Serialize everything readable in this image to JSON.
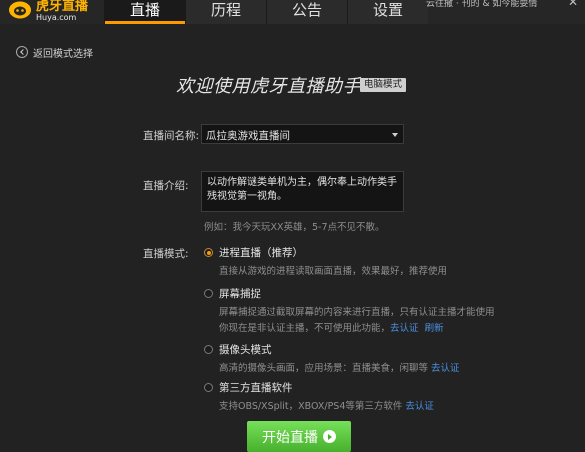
{
  "brand": {
    "name": "虎牙直播",
    "url": "Huya.com"
  },
  "tabs": [
    {
      "label": "直播",
      "active": true
    },
    {
      "label": "历程",
      "active": false
    },
    {
      "label": "公告",
      "active": false
    },
    {
      "label": "设置",
      "active": false
    }
  ],
  "user_area_text": "云往撒 · 刊的 & 如今能耍情",
  "back_label": "返回模式选择",
  "title": "欢迎使用虎牙直播助手",
  "mode_badge": "电脑模式",
  "form": {
    "room_name_label": "直播间名称:",
    "room_name_value": "瓜拉奥游戏直播间",
    "intro_label": "直播介绍:",
    "intro_value": "以动作解谜类单机为主，偶尔奉上动作类手残视觉第一视角。",
    "intro_hint": "例如：我今天玩XX英雄，5-7点不见不散。",
    "mode_label": "直播模式:"
  },
  "modes": [
    {
      "title": "进程直播（推荐）",
      "desc_lines": [
        "直接从游戏的进程读取画面直播，效果最好，推荐使用"
      ],
      "checked": true
    },
    {
      "title": "屏幕捕捉",
      "desc_lines": [
        "屏幕捕捉通过截取屏幕的内容来进行直播，只有认证主播才能使用",
        "你现在是非认证主播，不可使用此功能，"
      ],
      "links": [
        "去认证",
        "刷新"
      ],
      "checked": false
    },
    {
      "title": "摄像头模式",
      "desc_lines": [
        "高清的摄像头画面，应用场景：直播美食，闲聊等"
      ],
      "links": [
        "去认证"
      ],
      "checked": false
    },
    {
      "title": "第三方直播软件",
      "desc_lines": [
        "支持OBS/XSplit，XBOX/PS4等第三方软件"
      ],
      "links": [
        "去认证"
      ],
      "checked": false
    }
  ],
  "start_button": "开始直播",
  "colors": {
    "accent": "#ff9900",
    "start_green": "#5cc83c",
    "link_blue": "#4a8fe0",
    "background": "#222222"
  }
}
